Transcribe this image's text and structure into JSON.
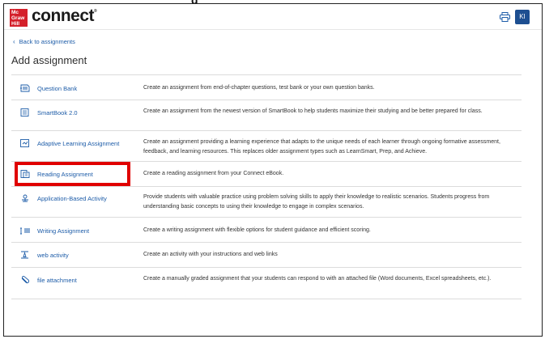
{
  "header": {
    "logo_lines": [
      "Mc",
      "Graw",
      "Hill"
    ],
    "brand": "connect",
    "user_initials": "KI"
  },
  "nav": {
    "back_label": "Back to assignments"
  },
  "page": {
    "title": "Add assignment"
  },
  "assignments": [
    {
      "icon": "question-bank-icon",
      "label": "Question Bank",
      "description": "Create an assignment from end-of-chapter questions, test bank or your own question banks."
    },
    {
      "icon": "smartbook-icon",
      "label": "SmartBook 2.0",
      "description": "Create an assignment from the newest version of SmartBook to help students maximize their studying and be better prepared for class."
    },
    {
      "icon": "adaptive-learning-icon",
      "label": "Adaptive Learning Assignment",
      "description": "Create an assignment providing a learning experience that adapts to the unique needs of each learner through ongoing formative assessment, feedback, and learning resources. This replaces older assignment types such as LearnSmart, Prep, and Achieve."
    },
    {
      "icon": "reading-assignment-icon",
      "label": "Reading Assignment",
      "description": "Create a reading assignment from your Connect eBook."
    },
    {
      "icon": "application-activity-icon",
      "label": "Application-Based Activity",
      "description": "Provide students with valuable practice using problem solving skills to apply their knowledge to realistic scenarios. Students progress from understanding basic concepts to using their knowledge to engage in complex scenarios."
    },
    {
      "icon": "writing-assignment-icon",
      "label": "Writing Assignment",
      "description": "Create a writing assignment with flexible options for student guidance and efficient scoring."
    },
    {
      "icon": "web-activity-icon",
      "label": "web activity",
      "description": "Create an activity with your instructions and web links"
    },
    {
      "icon": "file-attachment-icon",
      "label": "file attachment",
      "description": "Create a manually graded assignment that your students can respond to with an attached file (Word documents, Excel spreadsheets, etc.)."
    }
  ],
  "colors": {
    "link": "#1d5ca8",
    "highlight": "#e00000",
    "brand_red": "#d4202a",
    "avatar": "#1d4f91"
  }
}
